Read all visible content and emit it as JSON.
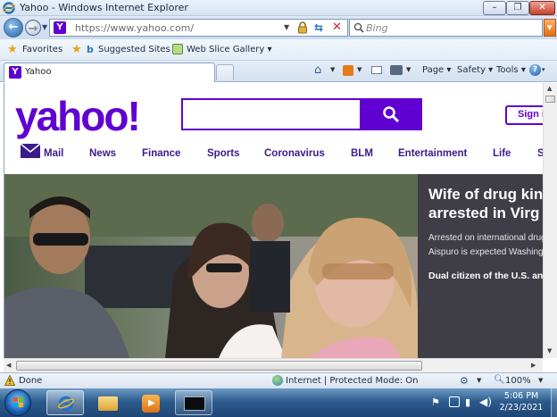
{
  "window": {
    "title": "Yahoo - Windows Internet Explorer",
    "min_label": "–",
    "max_label": "❐",
    "close_label": "✕"
  },
  "address_bar": {
    "url": "https://www.yahoo.com/",
    "search_placeholder": "Bing"
  },
  "favorites_bar": {
    "favorites_label": "Favorites",
    "items": [
      {
        "label": "Suggested Sites ▾"
      },
      {
        "label": "Web Slice Gallery ▾"
      }
    ]
  },
  "tab": {
    "label": "Yahoo"
  },
  "command_bar": {
    "page_label": "Page ▾",
    "safety_label": "Safety ▾",
    "tools_label": "Tools ▾",
    "help_label": "▾"
  },
  "page": {
    "logo_text": "yahoo!",
    "search_placeholder": "",
    "signin_label": "Sign i",
    "nav": [
      {
        "label": "Mail"
      },
      {
        "label": "News"
      },
      {
        "label": "Finance"
      },
      {
        "label": "Sports"
      },
      {
        "label": "Coronavirus"
      },
      {
        "label": "BLM"
      },
      {
        "label": "Entertainment"
      },
      {
        "label": "Life"
      },
      {
        "label": "S"
      }
    ],
    "hero": {
      "headline": "Wife of drug kin arrested in Virg",
      "summary": "Arrested on international drug Coronel Aispuro is expected Washington on Tuesday.",
      "subhead": "Dual citizen of the U.S. an"
    }
  },
  "status_bar": {
    "status": "Done",
    "zone": "Internet | Protected Mode: On",
    "zoom": "100%"
  },
  "taskbar": {
    "time": "5:06 PM",
    "date": "2/23/2021"
  },
  "colors": {
    "brand": "#6001d2",
    "hero_panel": "#3f3d46"
  }
}
